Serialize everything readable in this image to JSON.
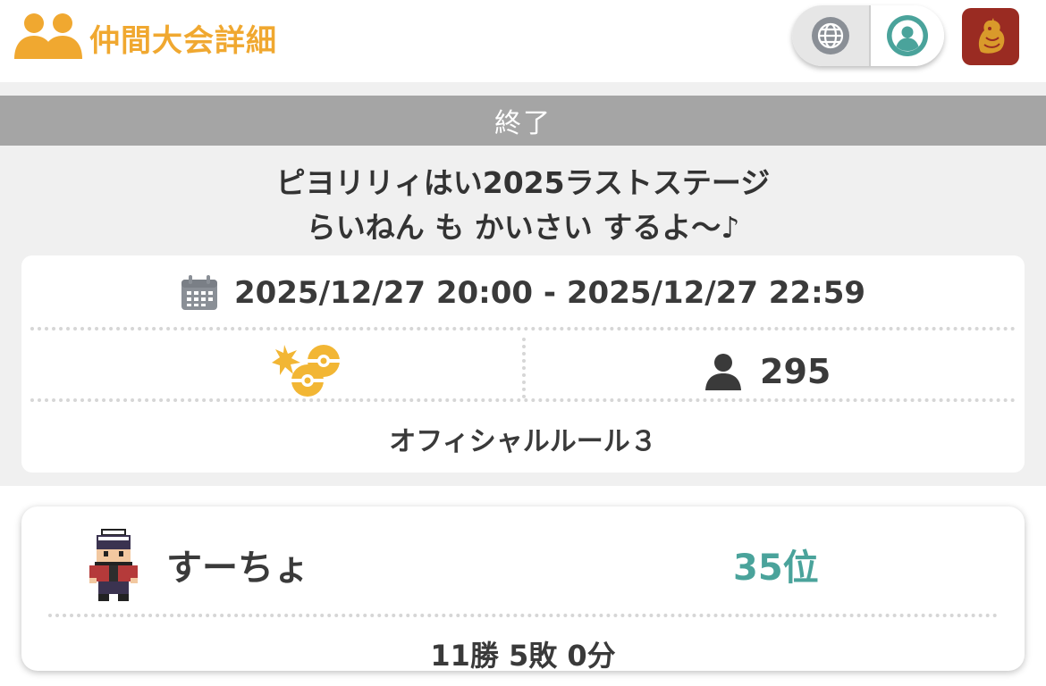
{
  "header": {
    "title": "仲間大会詳細",
    "icon": "group-icon",
    "accent_color": "#f0a830"
  },
  "toggle": {
    "left_icon": "globe-icon",
    "right_icon": "user-circle-icon",
    "active_color": "#4aa39b"
  },
  "status": {
    "label": "終了"
  },
  "event": {
    "title_line1": "ピヨリリィはい2025ラストステージ",
    "title_line2": "らいねん も かいさい するよ〜♪"
  },
  "info": {
    "date_range": "2025/12/27 20:00 - 2025/12/27 22:59",
    "participants": "295",
    "rule": "オフィシャルルール３"
  },
  "player": {
    "name": "すーちょ",
    "rank": "35位",
    "record": "11勝 5敗 0分"
  }
}
